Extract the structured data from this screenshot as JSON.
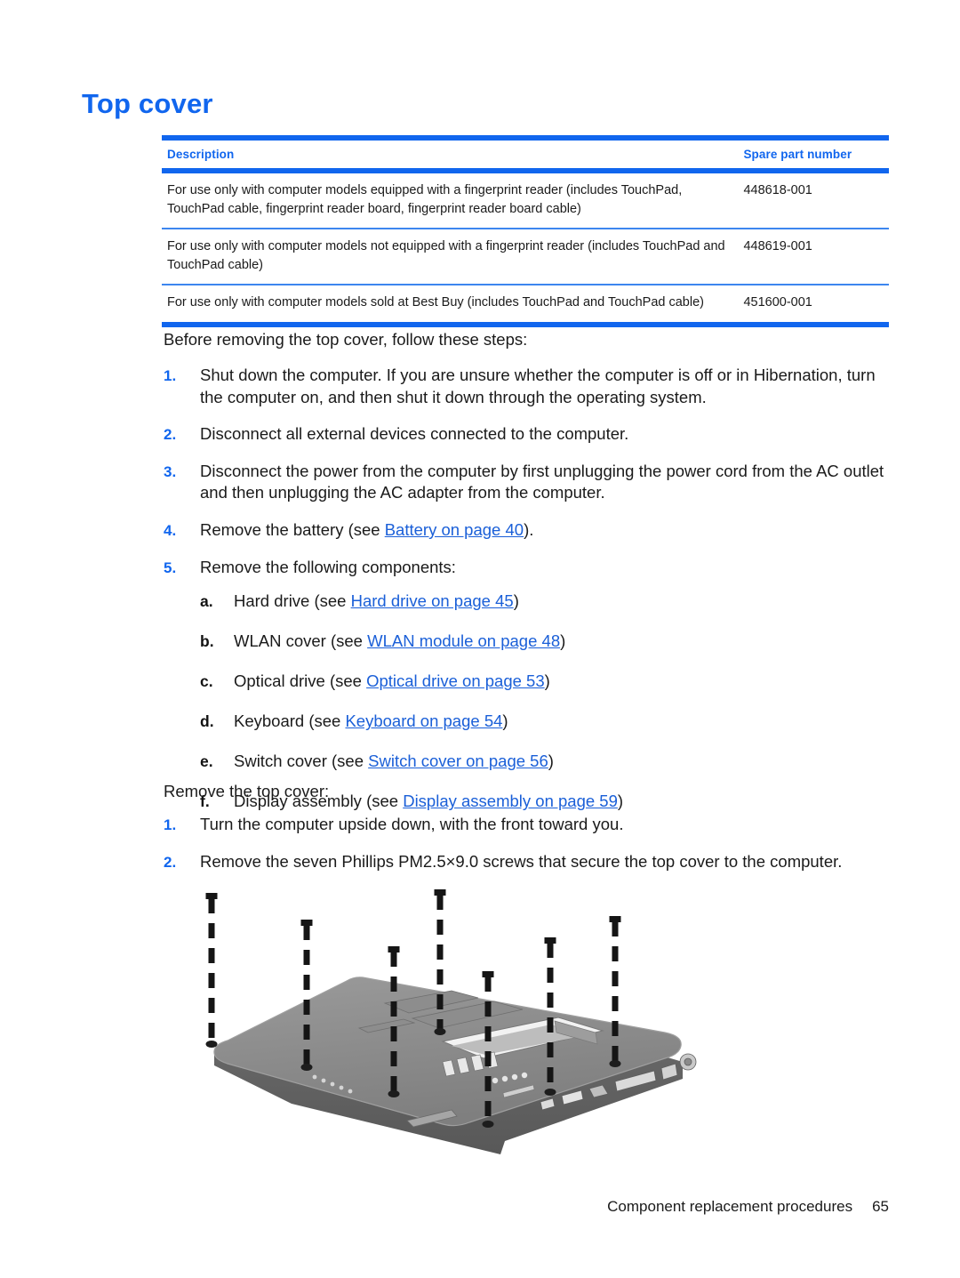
{
  "document": {
    "title": "Top cover"
  },
  "colors": {
    "heading_blue": "#1166ee",
    "rule_blue": "#1166ee",
    "rule_thin_blue": "#3d86ef",
    "link_blue": "#1a5fd8",
    "body_text": "#1a1a1a"
  },
  "table": {
    "headers": {
      "description": "Description",
      "spare_part_number": "Spare part number"
    },
    "rows": [
      {
        "description": "For use only with computer models equipped with a fingerprint reader (includes TouchPad, TouchPad cable, fingerprint reader board, fingerprint reader board cable)",
        "spare_part_number": "448618-001"
      },
      {
        "description": "For use only with computer models not equipped with a fingerprint reader (includes TouchPad and TouchPad cable)",
        "spare_part_number": "448619-001"
      },
      {
        "description": "For use only with computer models sold at Best Buy (includes TouchPad and TouchPad cable)",
        "spare_part_number": "451600-001"
      }
    ]
  },
  "before_section": {
    "intro": "Before removing the top cover, follow these steps:",
    "steps": [
      {
        "marker": "1.",
        "text": "Shut down the computer. If you are unsure whether the computer is off or in Hibernation, turn the computer on, and then shut it down through the operating system."
      },
      {
        "marker": "2.",
        "text": "Disconnect all external devices connected to the computer."
      },
      {
        "marker": "3.",
        "text": "Disconnect the power from the computer by first unplugging the power cord from the AC outlet and then unplugging the AC adapter from the computer."
      },
      {
        "marker": "4.",
        "prefix": "Remove the battery (see ",
        "link": "Battery on page 40",
        "suffix": ")."
      },
      {
        "marker": "5.",
        "text": "Remove the following components:",
        "sublist": [
          {
            "marker": "a.",
            "prefix": "Hard drive (see ",
            "link": "Hard drive on page 45",
            "suffix": ")"
          },
          {
            "marker": "b.",
            "prefix": "WLAN cover (see ",
            "link": "WLAN module on page 48",
            "suffix": ")"
          },
          {
            "marker": "c.",
            "prefix": "Optical drive (see ",
            "link": "Optical drive on page 53",
            "suffix": ")"
          },
          {
            "marker": "d.",
            "prefix": "Keyboard (see ",
            "link": "Keyboard on page 54",
            "suffix": ")"
          },
          {
            "marker": "e.",
            "prefix": "Switch cover (see ",
            "link": "Switch cover on page 56",
            "suffix": ")"
          },
          {
            "marker": "f.",
            "prefix": "Display assembly (see ",
            "link": "Display assembly on page 59",
            "suffix": ")"
          }
        ]
      }
    ]
  },
  "remove_section": {
    "intro": "Remove the top cover:",
    "steps": [
      {
        "marker": "1.",
        "text": "Turn the computer upside down, with the front toward you."
      },
      {
        "marker": "2.",
        "text": "Remove the seven Phillips PM2.5×9.0 screws that secure the top cover to the computer."
      }
    ]
  },
  "figure": {
    "caption": "",
    "alt": "Underside of notebook computer base enclosure with seven screw removal callouts shown as dashed alignment lines",
    "screw_count": 7
  },
  "footer": {
    "text": "Component replacement procedures",
    "page_number": "65"
  }
}
